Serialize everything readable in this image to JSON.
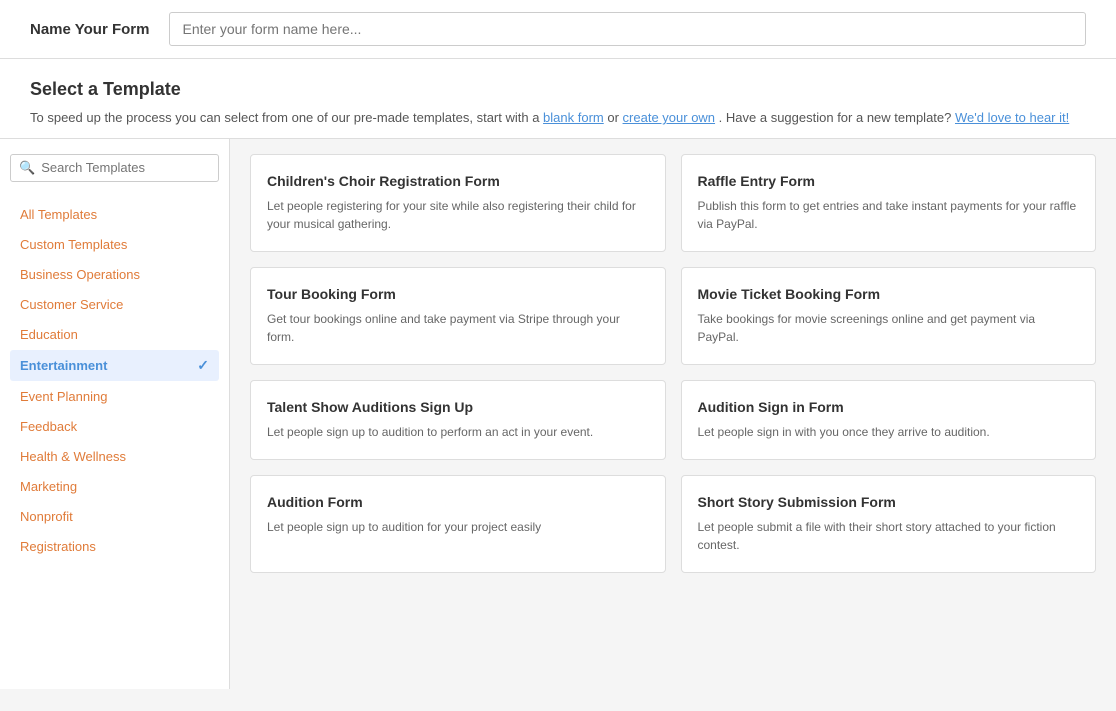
{
  "header": {
    "title": "Name Your Form",
    "input_placeholder": "Enter your form name here..."
  },
  "select_template": {
    "title": "Select a Template",
    "desc_prefix": "To speed up the process you can select from one of our pre-made templates, start with a ",
    "link_blank": "blank form",
    "desc_middle": " or ",
    "link_create": "create your own",
    "desc_suffix": ". Have a suggestion for a new template? ",
    "link_hear": "We'd love to hear it!",
    "search_placeholder": "Search Templates"
  },
  "sidebar": {
    "items": [
      {
        "label": "All Templates",
        "active": false
      },
      {
        "label": "Custom Templates",
        "active": false
      },
      {
        "label": "Business Operations",
        "active": false
      },
      {
        "label": "Customer Service",
        "active": false
      },
      {
        "label": "Education",
        "active": false
      },
      {
        "label": "Entertainment",
        "active": true
      },
      {
        "label": "Event Planning",
        "active": false
      },
      {
        "label": "Feedback",
        "active": false
      },
      {
        "label": "Health & Wellness",
        "active": false
      },
      {
        "label": "Marketing",
        "active": false
      },
      {
        "label": "Nonprofit",
        "active": false
      },
      {
        "label": "Registrations",
        "active": false
      }
    ]
  },
  "templates": [
    {
      "title": "Children's Choir Registration Form",
      "desc": "Let people registering for your site while also registering their child for your musical gathering."
    },
    {
      "title": "Raffle Entry Form",
      "desc": "Publish this form to get entries and take instant payments for your raffle via PayPal."
    },
    {
      "title": "Tour Booking Form",
      "desc": "Get tour bookings online and take payment via Stripe through your form."
    },
    {
      "title": "Movie Ticket Booking Form",
      "desc": "Take bookings for movie screenings online and get payment via PayPal."
    },
    {
      "title": "Talent Show Auditions Sign Up",
      "desc": "Let people sign up to audition to perform an act in your event."
    },
    {
      "title": "Audition Sign in Form",
      "desc": "Let people sign in with you once they arrive to audition."
    },
    {
      "title": "Audition Form",
      "desc": "Let people sign up to audition for your project easily"
    },
    {
      "title": "Short Story Submission Form",
      "desc": "Let people submit a file with their short story attached to your fiction contest."
    }
  ]
}
